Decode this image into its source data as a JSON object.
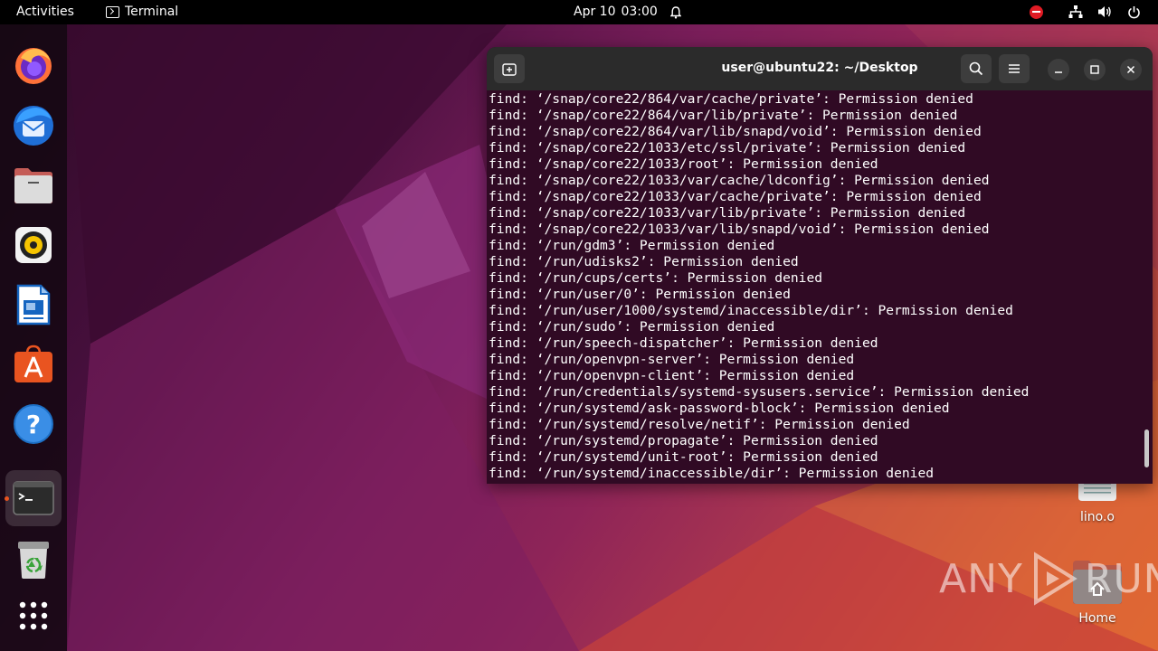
{
  "topbar": {
    "activities": "Activities",
    "app_name": "Terminal",
    "date": "Apr 10",
    "time": "03:00"
  },
  "dock": {
    "items": [
      {
        "name": "firefox-icon"
      },
      {
        "name": "thunderbird-icon"
      },
      {
        "name": "files-icon"
      },
      {
        "name": "rhythmbox-icon"
      },
      {
        "name": "libreoffice-writer-icon"
      },
      {
        "name": "app-center-icon"
      },
      {
        "name": "help-icon"
      },
      {
        "name": "terminal-icon"
      },
      {
        "name": "trash-icon"
      },
      {
        "name": "show-apps-icon"
      }
    ]
  },
  "desktop": {
    "icons": [
      {
        "label": "lino.o"
      },
      {
        "label": "Home"
      }
    ]
  },
  "watermark": {
    "text_left": "ANY",
    "text_right": "RUN"
  },
  "terminal": {
    "title": "user@ubuntu22: ~/Desktop",
    "lines": [
      "find: ‘/snap/core22/864/var/cache/private’: Permission denied",
      "find: ‘/snap/core22/864/var/lib/private’: Permission denied",
      "find: ‘/snap/core22/864/var/lib/snapd/void’: Permission denied",
      "find: ‘/snap/core22/1033/etc/ssl/private’: Permission denied",
      "find: ‘/snap/core22/1033/root’: Permission denied",
      "find: ‘/snap/core22/1033/var/cache/ldconfig’: Permission denied",
      "find: ‘/snap/core22/1033/var/cache/private’: Permission denied",
      "find: ‘/snap/core22/1033/var/lib/private’: Permission denied",
      "find: ‘/snap/core22/1033/var/lib/snapd/void’: Permission denied",
      "find: ‘/run/gdm3’: Permission denied",
      "find: ‘/run/udisks2’: Permission denied",
      "find: ‘/run/cups/certs’: Permission denied",
      "find: ‘/run/user/0’: Permission denied",
      "find: ‘/run/user/1000/systemd/inaccessible/dir’: Permission denied",
      "find: ‘/run/sudo’: Permission denied",
      "find: ‘/run/speech-dispatcher’: Permission denied",
      "find: ‘/run/openvpn-server’: Permission denied",
      "find: ‘/run/openvpn-client’: Permission denied",
      "find: ‘/run/credentials/systemd-sysusers.service’: Permission denied",
      "find: ‘/run/systemd/ask-password-block’: Permission denied",
      "find: ‘/run/systemd/resolve/netif’: Permission denied",
      "find: ‘/run/systemd/propagate’: Permission denied",
      "find: ‘/run/systemd/unit-root’: Permission denied",
      "find: ‘/run/systemd/inaccessible/dir’: Permission denied"
    ]
  },
  "colors": {
    "terminal_bg": "#300a24",
    "titlebar_bg": "#2b2b2b",
    "accent": "#e95420"
  }
}
